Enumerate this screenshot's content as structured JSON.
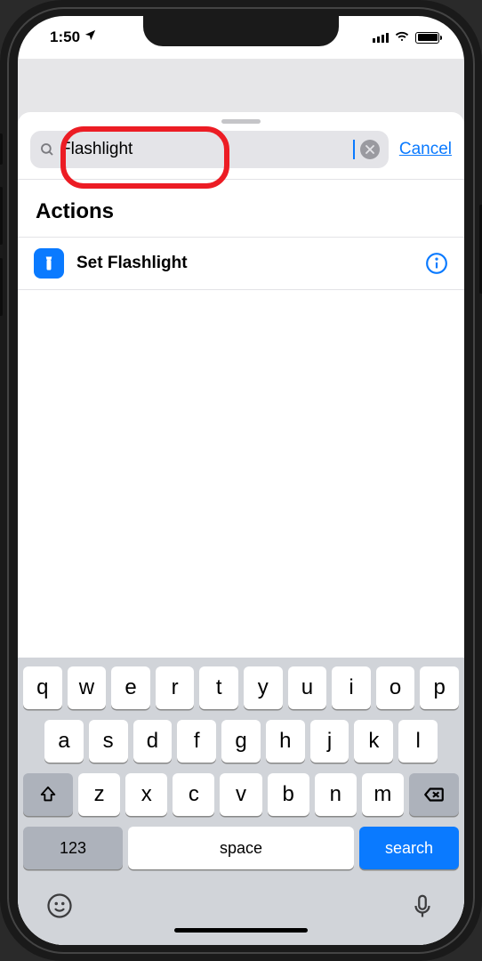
{
  "status": {
    "time": "1:50"
  },
  "search": {
    "value": "Flashlight",
    "cancel": "Cancel"
  },
  "section": {
    "title": "Actions"
  },
  "actions": [
    {
      "label": "Set Flashlight"
    }
  ],
  "keyboard": {
    "row1": [
      "q",
      "w",
      "e",
      "r",
      "t",
      "y",
      "u",
      "i",
      "o",
      "p"
    ],
    "row2": [
      "a",
      "s",
      "d",
      "f",
      "g",
      "h",
      "j",
      "k",
      "l"
    ],
    "row3": [
      "z",
      "x",
      "c",
      "v",
      "b",
      "n",
      "m"
    ],
    "numKey": "123",
    "spaceKey": "space",
    "actionKey": "search"
  }
}
